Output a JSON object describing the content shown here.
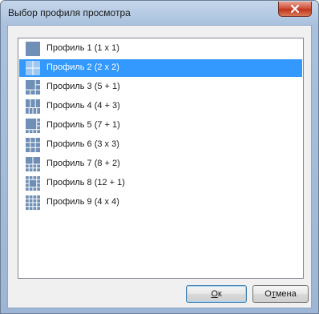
{
  "window": {
    "title": "Выбор профиля просмотра"
  },
  "profiles": [
    {
      "label": "Профиль 1 (1 x 1)",
      "selected": false,
      "icon": "layout-1x1-icon"
    },
    {
      "label": "Профиль 2 (2 x 2)",
      "selected": true,
      "icon": "layout-2x2-icon"
    },
    {
      "label": "Профиль 3 (5 + 1)",
      "selected": false,
      "icon": "layout-5plus1-icon"
    },
    {
      "label": "Профиль 4 (4 + 3)",
      "selected": false,
      "icon": "layout-4plus3-icon"
    },
    {
      "label": "Профиль 5 (7 + 1)",
      "selected": false,
      "icon": "layout-7plus1-icon"
    },
    {
      "label": "Профиль 6 (3 x 3)",
      "selected": false,
      "icon": "layout-3x3-icon"
    },
    {
      "label": "Профиль 7 (8 + 2)",
      "selected": false,
      "icon": "layout-8plus2-icon"
    },
    {
      "label": "Профиль 8 (12 + 1)",
      "selected": false,
      "icon": "layout-12plus1-icon"
    },
    {
      "label": "Профиль 9 (4 x 4)",
      "selected": false,
      "icon": "layout-4x4-icon"
    }
  ],
  "buttons": {
    "ok_accel": "О",
    "ok_rest": "к",
    "cancel_accel": "т",
    "cancel_pre": "О",
    "cancel_rest": "мена"
  },
  "colors": {
    "selection": "#3399ff",
    "icon_fill": "#6f8fb6"
  }
}
